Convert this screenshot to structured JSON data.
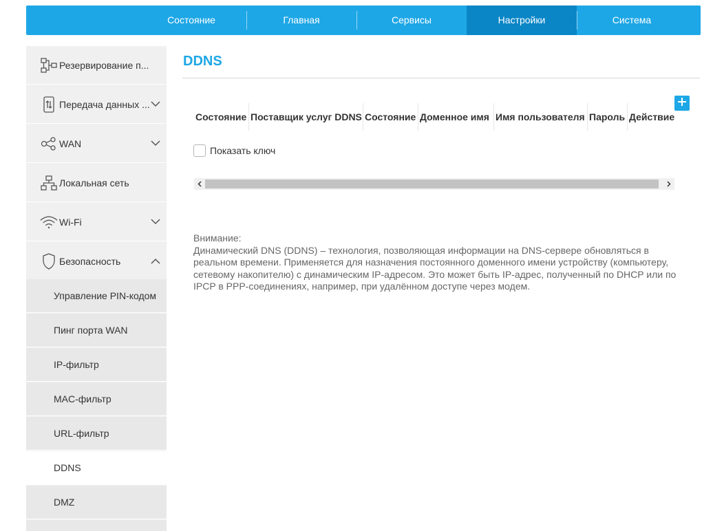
{
  "topnav": {
    "tabs": [
      {
        "label": "Состояние",
        "active": false
      },
      {
        "label": "Главная",
        "active": false
      },
      {
        "label": "Сервисы",
        "active": false
      },
      {
        "label": "Настройки",
        "active": true
      },
      {
        "label": "Система",
        "active": false
      }
    ]
  },
  "sidebar": {
    "items": [
      {
        "label": "Резервирование п...",
        "icon": "network-backup-icon",
        "chevron": "none"
      },
      {
        "label": "Передача данных ...",
        "icon": "mobile-data-icon",
        "chevron": "down"
      },
      {
        "label": "WAN",
        "icon": "wan-icon",
        "chevron": "down"
      },
      {
        "label": "Локальная сеть",
        "icon": "lan-icon",
        "chevron": "none"
      },
      {
        "label": "Wi-Fi",
        "icon": "wifi-icon",
        "chevron": "down"
      },
      {
        "label": "Безопасность",
        "icon": "shield-icon",
        "chevron": "up"
      }
    ],
    "sub_items": [
      {
        "label": "Управление PIN-кодом",
        "active": false
      },
      {
        "label": "Пинг порта WAN",
        "active": false
      },
      {
        "label": "IP-фильтр",
        "active": false
      },
      {
        "label": "MAC-фильтр",
        "active": false
      },
      {
        "label": "URL-фильтр",
        "active": false
      },
      {
        "label": "DDNS",
        "active": true
      },
      {
        "label": "DMZ",
        "active": false
      }
    ]
  },
  "main": {
    "title": "DDNS",
    "table": {
      "columns": [
        "Состояние",
        "Поставщик услуг DDNS",
        "Состояние",
        "Доменное имя",
        "Имя пользователя",
        "Пароль",
        "Действие"
      ],
      "rows": []
    },
    "show_key_label": "Показать ключ",
    "note_title": "Внимание:",
    "note_text": "Динамический DNS (DDNS) – технология, позволяющая информации на DNS-сервере обновляться в реальном времени. Применяется для назначения постоянного доменного имени устройству (компьютеру, сетевому накопителю) с динамическим IP-адресом. Это может быть IP-адрес, полученный по DHCP или по IPCP в PPP-соединениях, например, при удалённом доступе через модем."
  },
  "colors": {
    "accent": "#1ea7e6",
    "accent_active": "#0a86c6",
    "sidebar_bg": "#f0f0f0",
    "submenu_bg": "#e8e8e8"
  }
}
